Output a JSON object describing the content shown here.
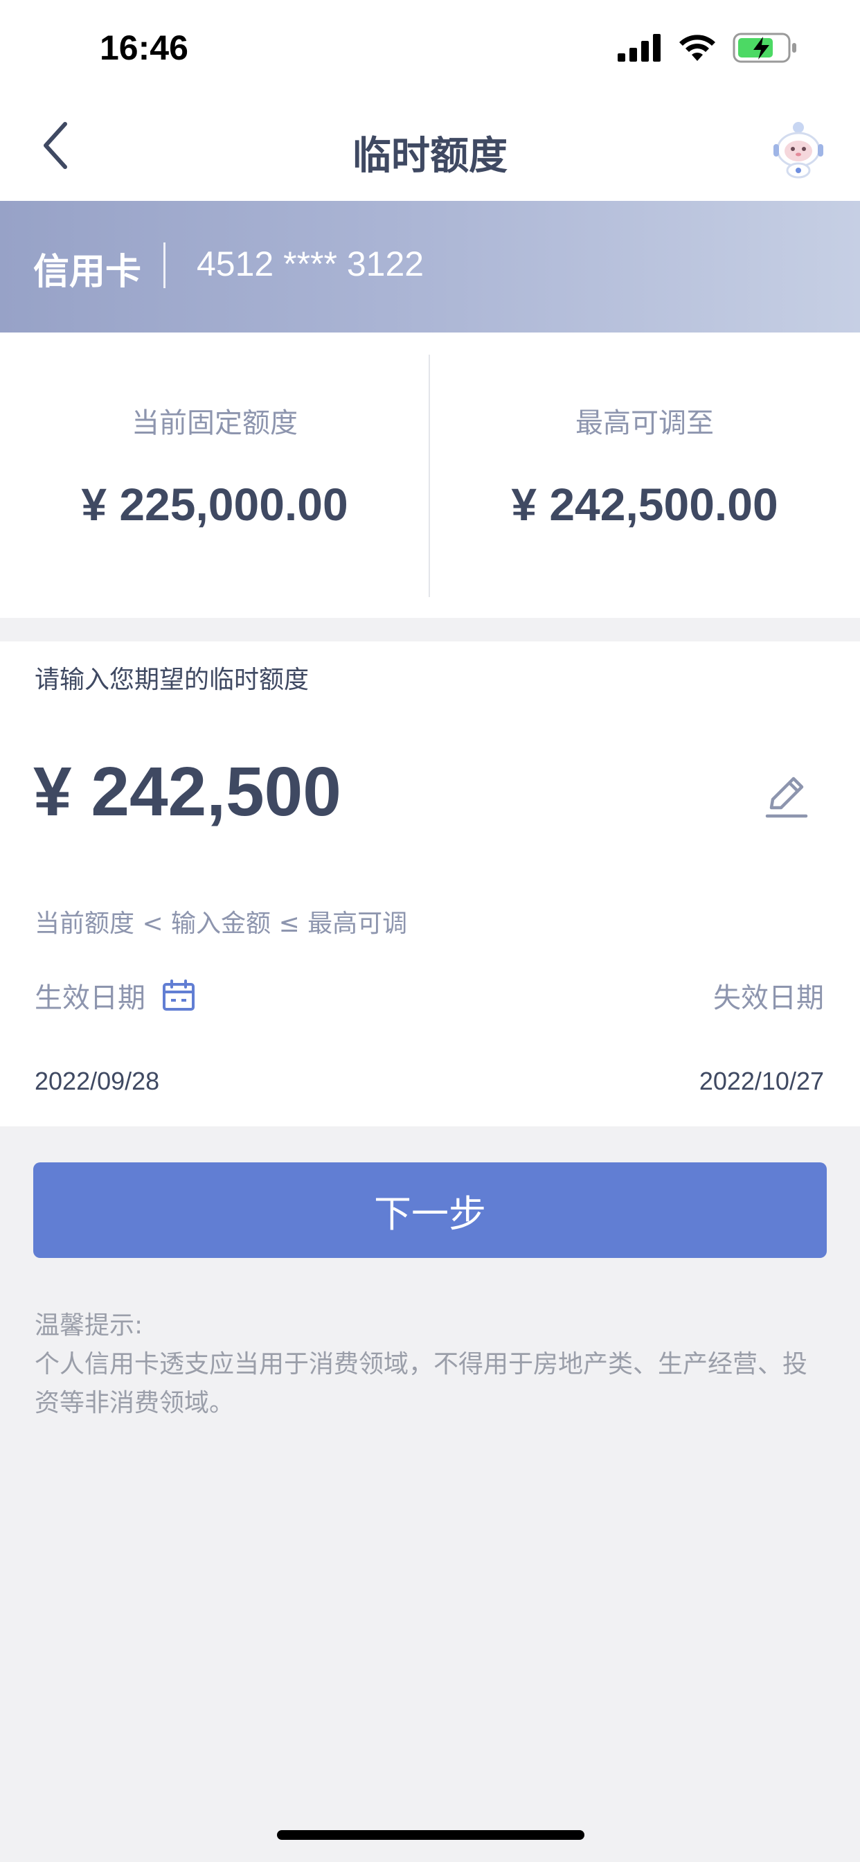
{
  "status_bar": {
    "time": "16:46",
    "icons": [
      "signal-icon",
      "wifi-icon",
      "battery-charging-icon"
    ],
    "battery_color": "#4cd964"
  },
  "navbar": {
    "title": "临时额度",
    "back_icon": "back-chevron-icon",
    "assistant_icon": "robot-assistant-avatar"
  },
  "card": {
    "type": "信用卡",
    "number": "4512 **** 3122"
  },
  "limits": {
    "current_label": "当前固定额度",
    "current_value": "¥ 225,000.00",
    "max_label": "最高可调至",
    "max_value": "¥ 242,500.00"
  },
  "input": {
    "prompt": "请输入您期望的临时额度",
    "amount": "¥ 242,500",
    "edit_icon": "edit-pencil-icon",
    "range_hint": "当前额度 < 输入金额 ≤ 最高可调"
  },
  "dates": {
    "effective_label": "生效日期",
    "calendar_icon": "calendar-icon",
    "expiry_label": "失效日期",
    "effective_date": "2022/09/28",
    "expiry_date": "2022/10/27"
  },
  "next_button": "下一步",
  "tips": {
    "title": "温馨提示:",
    "body": "个人信用卡透支应当用于消费领域，不得用于房地产类、生产经营、投资等非消费领域。"
  },
  "colors": {
    "accent": "#617ed3",
    "text_dark": "#3f4962",
    "text_muted": "#8d95ae",
    "banner_start": "#97a2c7",
    "banner_end": "#c6cfe4"
  }
}
